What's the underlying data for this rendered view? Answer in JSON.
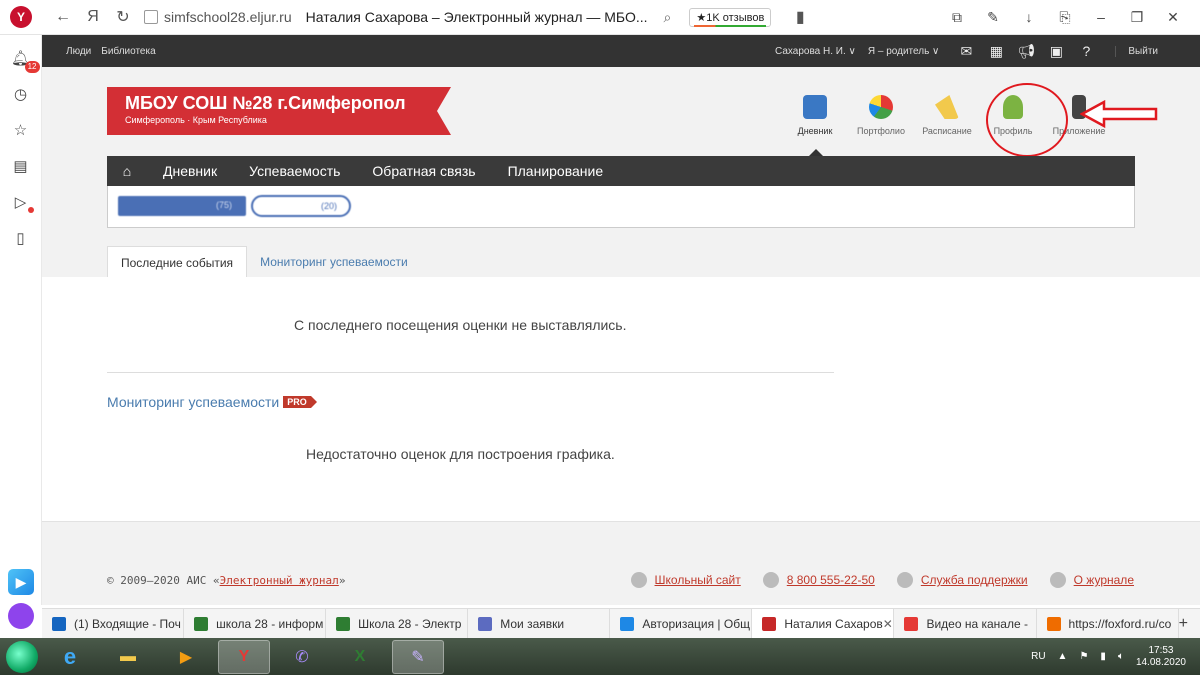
{
  "browser": {
    "logo": "Y",
    "ya_button": "Я",
    "url": "simfschool28.eljur.ru",
    "page_title": "Наталия Сахарова – Электронный журнал — МБО...",
    "reviews_badge": "★1K отзывов"
  },
  "sidebar": {
    "notifications_badge": "12"
  },
  "site_top": {
    "links": [
      "Люди",
      "Библиотека"
    ],
    "user": "Сахарова Н. И. ∨",
    "role": "Я – родитель ∨",
    "exit": "Выйти"
  },
  "school": {
    "name": "МБОУ СОШ №28 г.Симферопол",
    "location": "Симферополь · Крым Республика"
  },
  "apps": [
    {
      "label": "Дневник",
      "icon": "diary-icon"
    },
    {
      "label": "Портфолио",
      "icon": "portfolio-icon"
    },
    {
      "label": "Расписание",
      "icon": "schedule-icon"
    },
    {
      "label": "Профиль",
      "icon": "profile-icon"
    },
    {
      "label": "Приложение",
      "icon": "phone-app-icon"
    }
  ],
  "menu": [
    "Дневник",
    "Успеваемость",
    "Обратная связь",
    "Планирование"
  ],
  "children": [
    "(75)",
    "(20)"
  ],
  "tabs": [
    "Последние события",
    "Мониторинг успеваемости"
  ],
  "content": {
    "no_marks": "С последнего посещения оценки не выставлялись.",
    "monitoring_title": "Мониторинг успеваемости",
    "pro": "PRO",
    "no_graph": "Недостаточно оценок для построения графика."
  },
  "footer": {
    "copy_prefix": "© 2009–2020 АИС «",
    "copy_link": "Электронный журнал",
    "copy_suffix": "»",
    "links": [
      "Школьный сайт",
      "8 800 555-22-50",
      "Служба поддержки",
      "О журнале"
    ]
  },
  "browser_tabs": [
    {
      "label": "(1) Входящие - Поч",
      "color": "#1565c0"
    },
    {
      "label": "школа 28 - информ",
      "color": "#2e7d32"
    },
    {
      "label": "Школа 28 - Электр",
      "color": "#2e7d32"
    },
    {
      "label": "Мои заявки",
      "color": "#5c6bc0"
    },
    {
      "label": "Авторизация | Общ",
      "color": "#1e88e5"
    },
    {
      "label": "Наталия Сахаров",
      "color": "#c62828"
    },
    {
      "label": "Видео на канале - ",
      "color": "#e53935"
    },
    {
      "label": "https://foxford.ru/co",
      "color": "#ef6c00"
    }
  ],
  "tray": {
    "lang": "RU",
    "time": "17:53",
    "date": "14.08.2020"
  }
}
